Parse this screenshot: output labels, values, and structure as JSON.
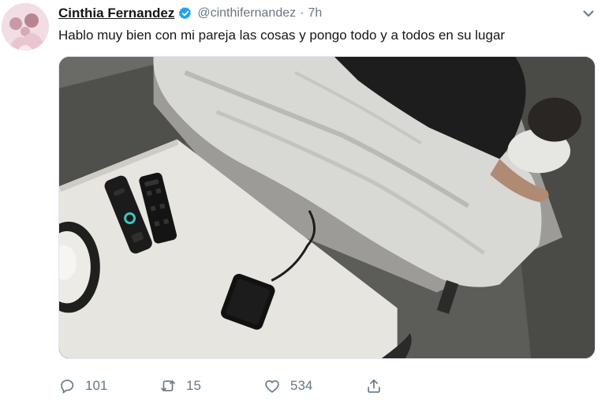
{
  "tweet": {
    "author_name": "Cinthia Fernandez",
    "handle": "@cinthifernandez",
    "separator": "·",
    "time": "7h",
    "verified": true,
    "text": "Hablo muy bien con mi pareja las cosas y pongo todo y a todos en su lugar",
    "media": {
      "type": "photo"
    },
    "actions": {
      "reply_count": "101",
      "retweet_count": "15",
      "like_count": "534"
    }
  },
  "icons": {
    "verified": "verified-badge-icon",
    "caret": "chevron-down-icon",
    "reply": "reply-icon",
    "retweet": "retweet-icon",
    "like": "heart-icon",
    "share": "share-icon"
  },
  "colors": {
    "text": "#14171a",
    "muted": "#657786",
    "verified": "#1da1f2"
  }
}
